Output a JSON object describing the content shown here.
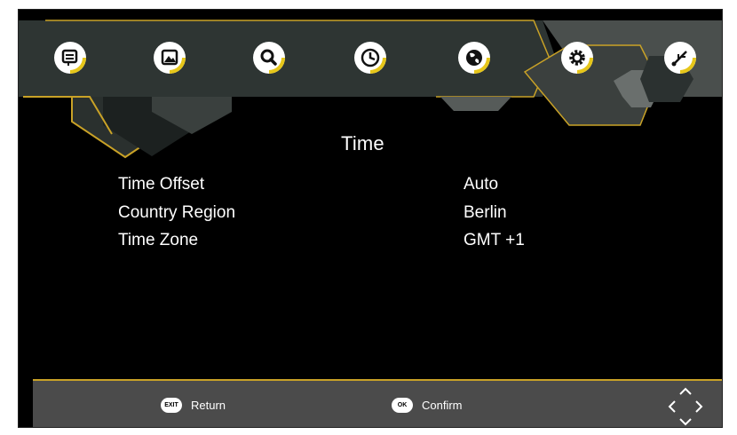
{
  "menu": {
    "items": [
      {
        "icon": "program-list-icon"
      },
      {
        "icon": "picture-icon"
      },
      {
        "icon": "search-icon"
      },
      {
        "icon": "time-clock-icon"
      },
      {
        "icon": "globe-icon"
      },
      {
        "icon": "gear-icon"
      },
      {
        "icon": "usb-icon"
      }
    ],
    "selected_index": 3
  },
  "page": {
    "title": "Time",
    "rows": [
      {
        "label": "Time Offset",
        "value": "Auto"
      },
      {
        "label": "Country Region",
        "value": "Berlin"
      },
      {
        "label": "Time Zone",
        "value": "GMT +1"
      }
    ]
  },
  "footer": {
    "exit_key": "EXIT",
    "exit_label": "Return",
    "ok_key": "OK",
    "ok_label": "Confirm",
    "nav_icon": "arrow-keys-icon"
  },
  "colors": {
    "accent": "#e6c619",
    "border_gold": "#c9a227",
    "panel_dark": "#2e3533",
    "footer_bg": "#4b4b4b"
  }
}
